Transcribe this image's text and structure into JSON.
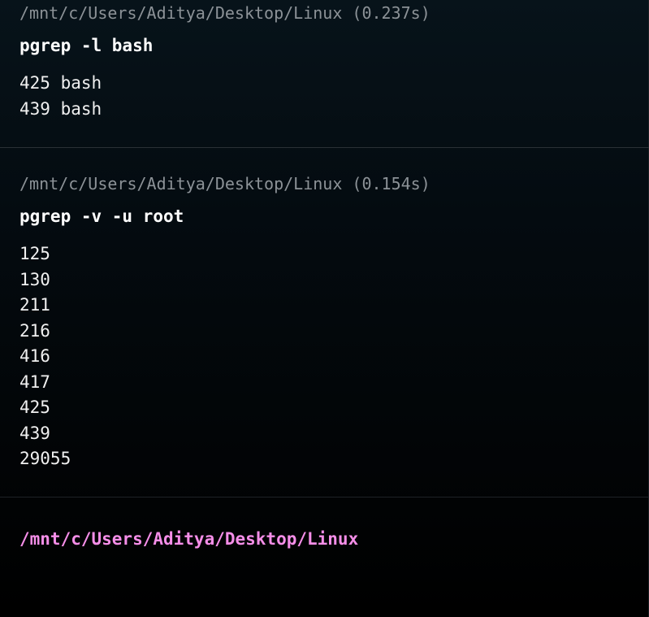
{
  "blocks": [
    {
      "path": "/mnt/c/Users/Aditya/Desktop/Linux",
      "duration": "(0.237s)",
      "command": "pgrep -l bash",
      "output": [
        "425 bash",
        "439 bash"
      ]
    },
    {
      "path": "/mnt/c/Users/Aditya/Desktop/Linux",
      "duration": "(0.154s)",
      "command": "pgrep -v -u root",
      "output": [
        "125",
        "130",
        "211",
        "216",
        "416",
        "417",
        "425",
        "439",
        "29055"
      ]
    }
  ],
  "prompt": {
    "path": "/mnt/c/Users/Aditya/Desktop/Linux"
  },
  "colors": {
    "prompt": "#f58ee8",
    "header": "#8c9297",
    "background": "#040b10"
  }
}
